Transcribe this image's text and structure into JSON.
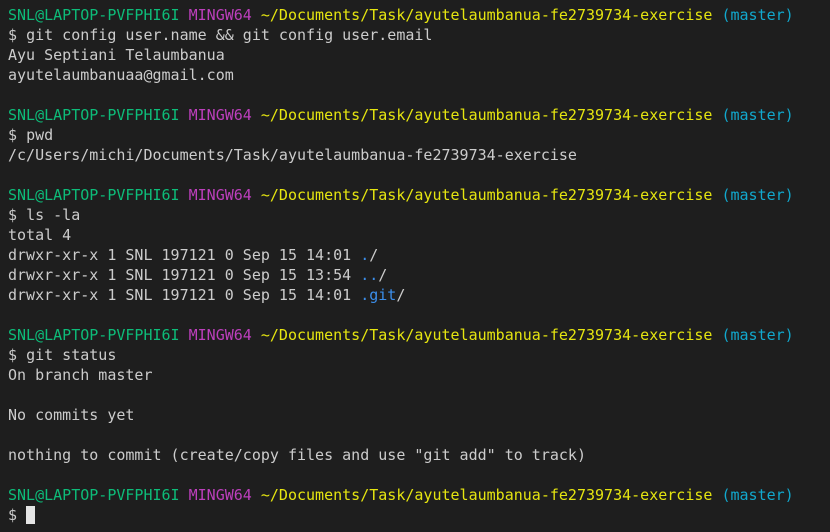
{
  "colors": {
    "background": "#1e1e1e",
    "text": "#cccccc",
    "user_host": "#0dbc79",
    "system": "#bc3fbc",
    "path": "#e5e510",
    "branch": "#11a8cd",
    "directory": "#3b8eea"
  },
  "prompt": {
    "user_host": "SNL@LAPTOP-PVFPHI6I",
    "system": "MINGW64",
    "path": "~/Documents/Task/ayutelaumbanua-fe2739734-exercise",
    "branch": "(master)",
    "symbol": "$"
  },
  "block1": {
    "command": "git config user.name && git config user.email",
    "output": [
      "Ayu Septiani Telaumbanua",
      "ayutelaumbanuaa@gmail.com"
    ]
  },
  "block2": {
    "command": "pwd",
    "output": [
      "/c/Users/michi/Documents/Task/ayutelaumbanua-fe2739734-exercise"
    ]
  },
  "block3": {
    "command": "ls -la",
    "total": "total 4",
    "entries": [
      {
        "meta": "drwxr-xr-x 1 SNL 197121 0 Sep 15 14:01",
        "name": ".",
        "suffix": "/"
      },
      {
        "meta": "drwxr-xr-x 1 SNL 197121 0 Sep 15 13:54",
        "name": "..",
        "suffix": "/"
      },
      {
        "meta": "drwxr-xr-x 1 SNL 197121 0 Sep 15 14:01",
        "name": ".git",
        "suffix": "/"
      }
    ]
  },
  "block4": {
    "command": "git status",
    "output": [
      "On branch master",
      "",
      "No commits yet",
      "",
      "nothing to commit (create/copy files and use \"git add\" to track)"
    ]
  }
}
